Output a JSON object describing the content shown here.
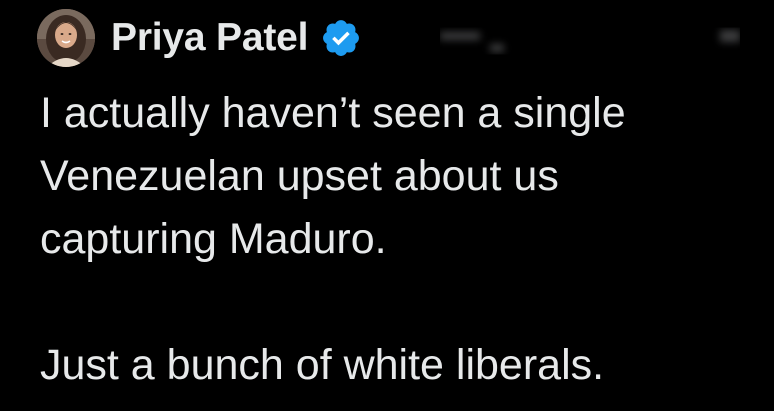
{
  "author": {
    "display_name": "Priya Patel",
    "avatar_icon": "profile-photo",
    "verified_icon": "verified-badge-icon",
    "verified_color": "#1d9bf0"
  },
  "post": {
    "lines": [
      "I actually haven’t seen a single",
      "Venezuelan upset about us",
      "capturing Maduro."
    ],
    "second_paragraph": "Just a bunch of white liberals."
  },
  "theme": {
    "background": "#000000",
    "text_color": "#e7e9ea"
  }
}
